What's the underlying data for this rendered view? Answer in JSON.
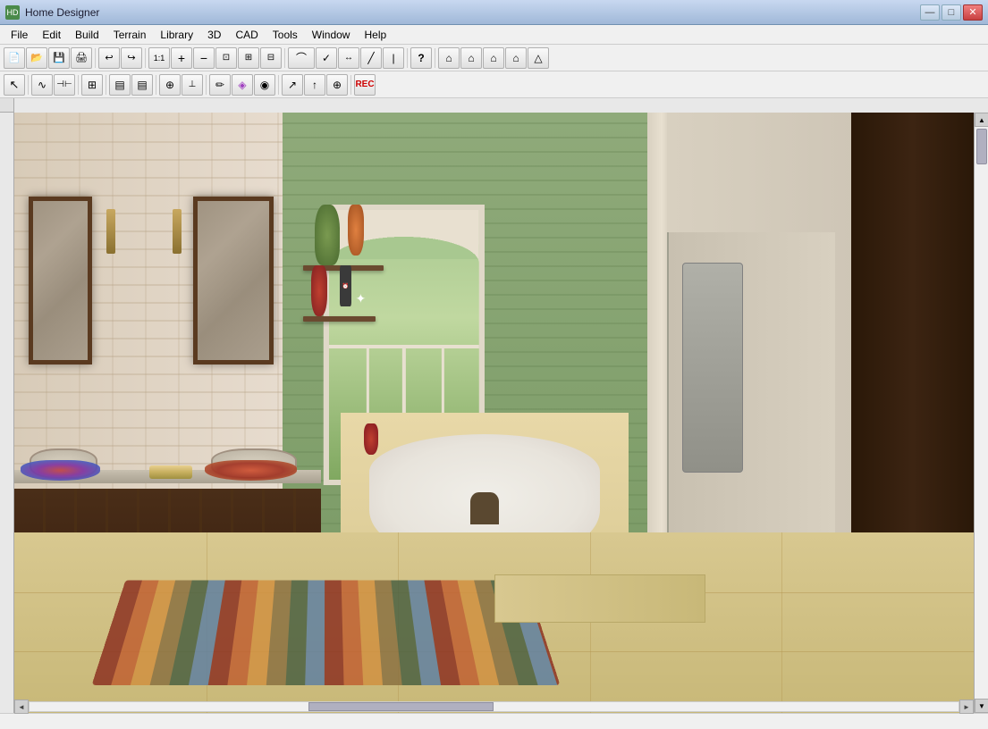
{
  "app": {
    "title": "Home Designer",
    "icon_label": "HD"
  },
  "window_controls": {
    "minimize": "—",
    "maximize": "□",
    "close": "✕"
  },
  "menu": {
    "items": [
      "File",
      "Edit",
      "Build",
      "Terrain",
      "Library",
      "3D",
      "CAD",
      "Tools",
      "Window",
      "Help"
    ]
  },
  "toolbar1": {
    "buttons": [
      {
        "name": "new",
        "icon": "📄"
      },
      {
        "name": "open",
        "icon": "📂"
      },
      {
        "name": "save",
        "icon": "💾"
      },
      {
        "name": "print",
        "icon": "🖨"
      },
      {
        "name": "undo",
        "icon": "↩"
      },
      {
        "name": "redo",
        "icon": "↪"
      },
      {
        "name": "zoom-out-btn",
        "icon": "🔍"
      },
      {
        "name": "zoom-in-btn",
        "icon": "🔍"
      },
      {
        "name": "zoom-fit",
        "icon": "⊡"
      },
      {
        "name": "zoom-window",
        "icon": "⊞"
      },
      {
        "name": "select-all",
        "icon": "⊟"
      },
      {
        "name": "move-view",
        "icon": "✛"
      },
      {
        "name": "arc-tool",
        "icon": "⌒"
      },
      {
        "name": "line-tool",
        "icon": "╱"
      },
      {
        "name": "check",
        "icon": "✓"
      },
      {
        "name": "pipe-tool",
        "icon": "|"
      },
      {
        "name": "dimension",
        "icon": "↔"
      },
      {
        "name": "question",
        "icon": "?"
      },
      {
        "name": "sep1",
        "icon": ""
      },
      {
        "name": "house-full",
        "icon": "⌂"
      },
      {
        "name": "house-front",
        "icon": "⌂"
      },
      {
        "name": "house-side",
        "icon": "⌂"
      },
      {
        "name": "house-camera",
        "icon": "⌂"
      },
      {
        "name": "roof-tool",
        "icon": "△"
      }
    ]
  },
  "toolbar2": {
    "buttons": [
      {
        "name": "select",
        "icon": "↖"
      },
      {
        "name": "spline",
        "icon": "∿"
      },
      {
        "name": "polyline",
        "icon": "⌐"
      },
      {
        "name": "grid",
        "icon": "⊞"
      },
      {
        "name": "cabinet",
        "icon": "▤"
      },
      {
        "name": "cabinet2",
        "icon": "▤"
      },
      {
        "name": "toggle-snap",
        "icon": "⊕"
      },
      {
        "name": "measure",
        "icon": "⊥"
      },
      {
        "name": "pencil",
        "icon": "✏"
      },
      {
        "name": "paint",
        "icon": "🎨"
      },
      {
        "name": "spray",
        "icon": "◉"
      },
      {
        "name": "pointer2",
        "icon": "↗"
      },
      {
        "name": "arrow-up",
        "icon": "↑"
      },
      {
        "name": "move",
        "icon": "⊕"
      },
      {
        "name": "record",
        "icon": "⬤"
      }
    ]
  },
  "status_bar": {
    "message": ""
  },
  "scene": {
    "description": "3D bathroom interior render"
  }
}
